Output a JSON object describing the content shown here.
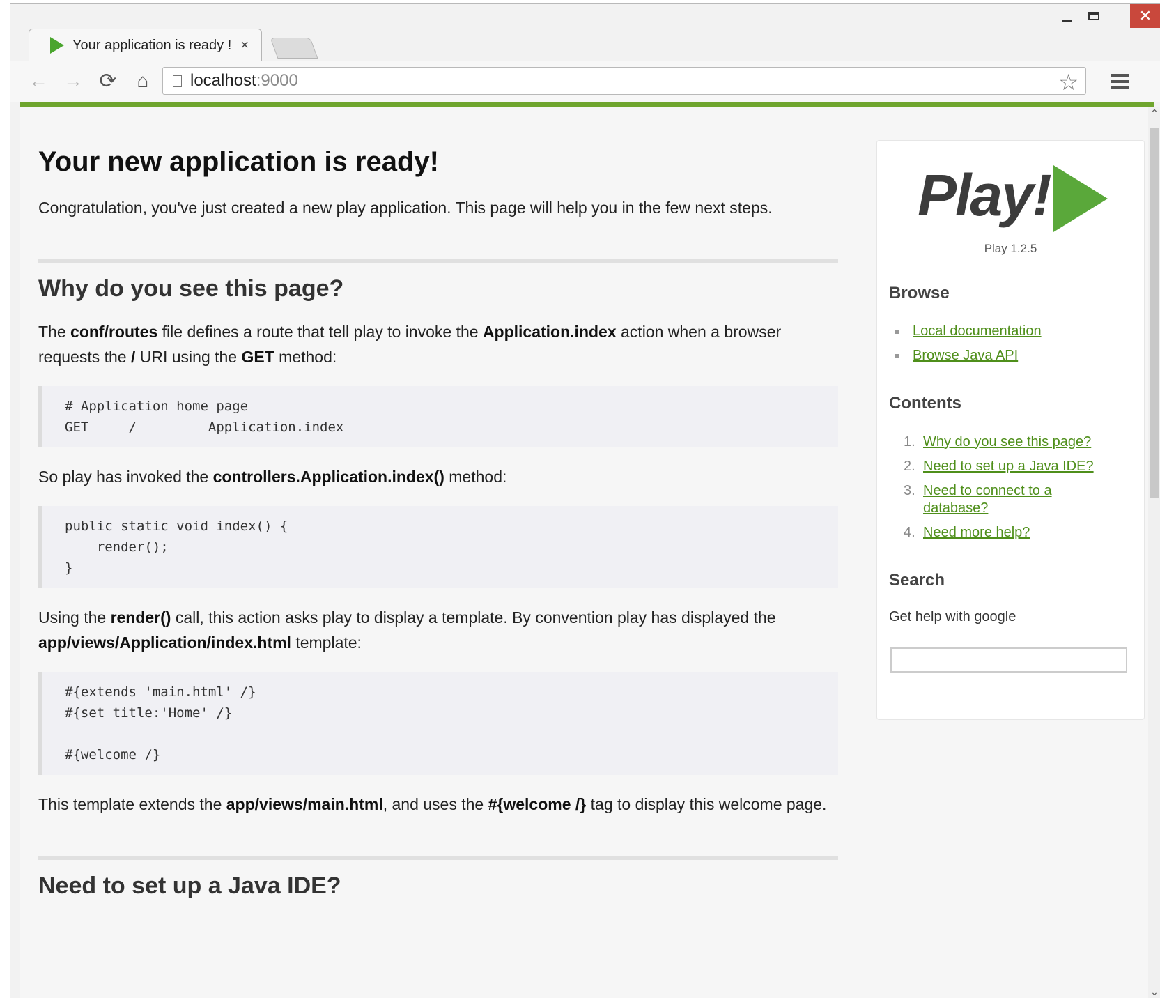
{
  "tab": {
    "title": "Your application is ready !",
    "close": "×"
  },
  "window": {
    "close": "✕"
  },
  "toolbar": {
    "back": "←",
    "forward": "→",
    "reload": "⟳",
    "home": "⌂",
    "url_host": "localhost",
    "url_port": ":9000",
    "star": "☆"
  },
  "main": {
    "heading": "Your new application is ready!",
    "intro": "Congratulation, you've just created a new play application. This page will help you in the few next steps.",
    "section1": {
      "title": "Why do you see this page?",
      "p1": [
        "The ",
        "conf/routes",
        " file defines a route that tell play to invoke the ",
        "Application.index",
        " action when a browser requests the ",
        "/",
        " URI using the ",
        "GET",
        " method:"
      ],
      "code1": "# Application home page\nGET     /         Application.index",
      "p2": [
        "So play has invoked the ",
        "controllers.Application.index()",
        " method:"
      ],
      "code2": "public static void index() {\n    render();\n}",
      "p3": [
        "Using the ",
        "render()",
        " call, this action asks play to display a template. By convention play has displayed the ",
        "app/views/Application/index.html",
        " template:"
      ],
      "code3": "#{extends 'main.html' /}\n#{set title:'Home' /}\n\n#{welcome /}",
      "p4": [
        "This template extends the ",
        "app/views/main.html",
        ", and uses the ",
        "#{welcome /}",
        " tag to display this welcome page."
      ]
    },
    "section2": {
      "title": "Need to set up a Java IDE?"
    }
  },
  "sidebar": {
    "logo_text": "Play!",
    "version": "Play 1.2.5",
    "browse_title": "Browse",
    "browse_links": [
      "Local documentation",
      "Browse Java API"
    ],
    "contents_title": "Contents",
    "contents": [
      {
        "num": "1.",
        "label": "Why do you see this page?"
      },
      {
        "num": "2.",
        "label": "Need to set up a Java IDE?"
      },
      {
        "num": "3.",
        "label": "Need to connect to a database?"
      },
      {
        "num": "4.",
        "label": "Need more help?"
      }
    ],
    "search_title": "Search",
    "search_help": "Get help with google",
    "search_value": ""
  },
  "colors": {
    "accent_green": "#6fa52e",
    "link_green": "#4f8f1b",
    "close_red": "#c9483c"
  }
}
